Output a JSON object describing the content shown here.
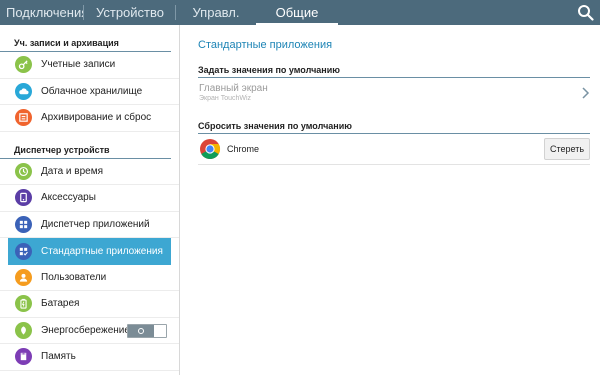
{
  "tabs": [
    {
      "label": "Подключения",
      "active": false
    },
    {
      "label": "Устройство",
      "active": false
    },
    {
      "label": "Управл.",
      "active": false
    },
    {
      "label": "Общие",
      "active": true
    }
  ],
  "search": {
    "icon": "search-icon"
  },
  "sidebar": {
    "sections": [
      {
        "title": "Уч. записи и архивация",
        "items": [
          {
            "label": "Учетные записи",
            "icon": "key-icon",
            "color": "#8bc34a"
          },
          {
            "label": "Облачное хранилище",
            "icon": "cloud-icon",
            "color": "#29a8d8"
          },
          {
            "label": "Архивирование и сброс",
            "icon": "backup-icon",
            "color": "#f0642e"
          }
        ]
      },
      {
        "title": "Диспетчер устройств",
        "items": [
          {
            "label": "Дата и время",
            "icon": "clock-icon",
            "color": "#8bc34a"
          },
          {
            "label": "Аксессуары",
            "icon": "accessory-icon",
            "color": "#5b3ea6"
          },
          {
            "label": "Диспетчер приложений",
            "icon": "apps-grid-icon",
            "color": "#3b62b8"
          },
          {
            "label": "Стандартные приложения",
            "icon": "default-apps-icon",
            "color": "#3b62b8",
            "selected": true
          },
          {
            "label": "Пользователи",
            "icon": "users-icon",
            "color": "#f59c1f"
          },
          {
            "label": "Батарея",
            "icon": "battery-icon",
            "color": "#8bc34a"
          },
          {
            "label": "Энергосбережение",
            "icon": "power-saving-icon",
            "color": "#8bc34a",
            "toggle": "off"
          },
          {
            "label": "Память",
            "icon": "memory-icon",
            "color": "#7d3db5"
          }
        ]
      }
    ]
  },
  "main": {
    "title": "Стандартные приложения",
    "sections": [
      {
        "title": "Задать значения по умолчанию"
      },
      {
        "title": "Сбросить значения по умолчанию"
      }
    ],
    "home_screen": {
      "title": "Главный экран",
      "subtitle": "Экран TouchWiz"
    },
    "apps": [
      {
        "name": "Chrome",
        "button": "Стереть"
      }
    ]
  },
  "colors": {
    "topbar": "#4c6a7c",
    "accent": "#3da7d2",
    "title_blue": "#1d84b5"
  }
}
